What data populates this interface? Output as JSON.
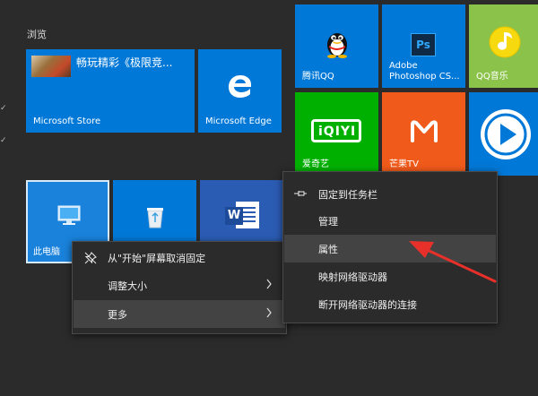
{
  "group_label": "浏览",
  "tiles": {
    "featured_text": "畅玩精彩《极限竞...",
    "store_label": "Microsoft Store",
    "edge_label": "Microsoft Edge",
    "qq_label": "腾讯QQ",
    "photoshop_label": "Adobe\nPhotoshop CS...",
    "photoshop_badge": "Ps",
    "qqmusic_label": "QQ音乐",
    "iqiyi_label": "爱奇艺",
    "mango_label": "芒果TV",
    "pc_label": "此电脑",
    "word_badge": "W"
  },
  "menu_main": {
    "unpin": "从\"开始\"屏幕取消固定",
    "resize": "调整大小",
    "more": "更多"
  },
  "menu_sub": {
    "pin_taskbar": "固定到任务栏",
    "manage": "管理",
    "properties": "属性",
    "map_drive": "映射网络驱动器",
    "disconnect_drive": "断开网络驱动器的连接"
  },
  "colors": {
    "tile_blue": "#0078d7",
    "qqmusic_green": "#8bc34a",
    "iqiyi_green": "#00b000",
    "mango_orange": "#f05a1a",
    "arrow_red": "#e8302a"
  }
}
